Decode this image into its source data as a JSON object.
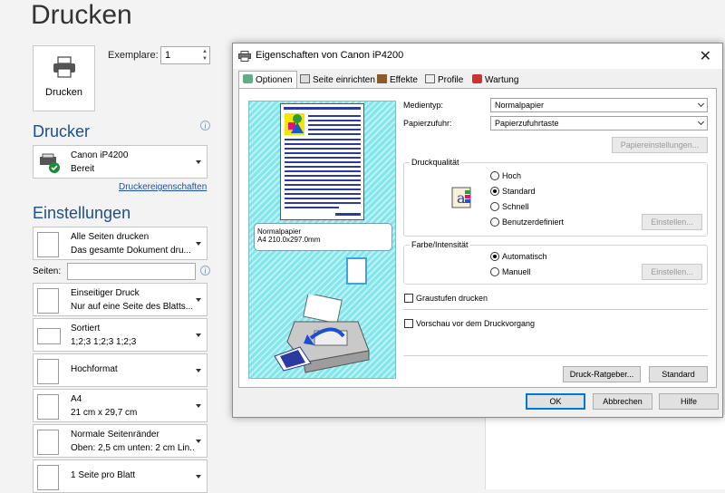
{
  "backstage": {
    "title": "Drucken",
    "print_button": "Drucken",
    "copies_label": "Exemplare:",
    "copies_value": "1",
    "printer_heading": "Drucker",
    "printer_name": "Canon iP4200",
    "printer_status": "Bereit",
    "printer_props_link": "Druckereigenschaften",
    "settings_heading": "Einstellungen",
    "pages_label": "Seiten:",
    "pages_value": "",
    "settings": [
      {
        "line1": "Alle Seiten drucken",
        "line2": "Das gesamte Dokument dru..."
      },
      {
        "line1": "Einseitiger Druck",
        "line2": "Nur auf eine Seite des Blatts..."
      },
      {
        "line1": "Sortiert",
        "line2": "1;2;3    1;2;3    1;2;3"
      },
      {
        "line1": "Hochformat",
        "line2": ""
      },
      {
        "line1": "A4",
        "line2": "21 cm x 29,7 cm"
      },
      {
        "line1": "Normale Seitenränder",
        "line2": "Oben: 2,5 cm unten: 2 cm Lin..."
      },
      {
        "line1": "1 Seite pro Blatt",
        "line2": ""
      }
    ]
  },
  "dialog": {
    "title": "Eigenschaften von Canon iP4200",
    "close_symbol": "✕",
    "tabs": [
      "Optionen",
      "Seite einrichten",
      "Effekte",
      "Profile",
      "Wartung"
    ],
    "active_tab": "Optionen",
    "preview_paper_label": "Normalpapier",
    "preview_size_label": "A4 210.0x297.0mm",
    "media_type_label": "Medientyp:",
    "media_type_value": "Normalpapier",
    "paper_source_label": "Papierzufuhr:",
    "paper_source_value": "Papierzufuhrtaste",
    "paper_settings_button": "Papiereinstellungen...",
    "quality_group": "Druckqualität",
    "quality_options": [
      "Hoch",
      "Standard",
      "Schnell",
      "Benutzerdefiniert"
    ],
    "quality_selected": "Standard",
    "quality_settings_button": "Einstellen...",
    "color_group": "Farbe/Intensität",
    "color_options": [
      "Automatisch",
      "Manuell"
    ],
    "color_selected": "Automatisch",
    "color_settings_button": "Einstellen...",
    "grayscale_label": "Graustufen drucken",
    "preview_before_label": "Vorschau vor dem Druckvorgang",
    "advisor_button": "Druck-Ratgeber...",
    "defaults_button": "Standard",
    "ok_button": "OK",
    "cancel_button": "Abbrechen",
    "help_button": "Hilfe"
  },
  "colors": {
    "accent_blue": "#1e4e8c",
    "link_blue": "#1f4fa3",
    "preview_cyan": "#82e6ea",
    "focus_blue": "#0078d7"
  }
}
